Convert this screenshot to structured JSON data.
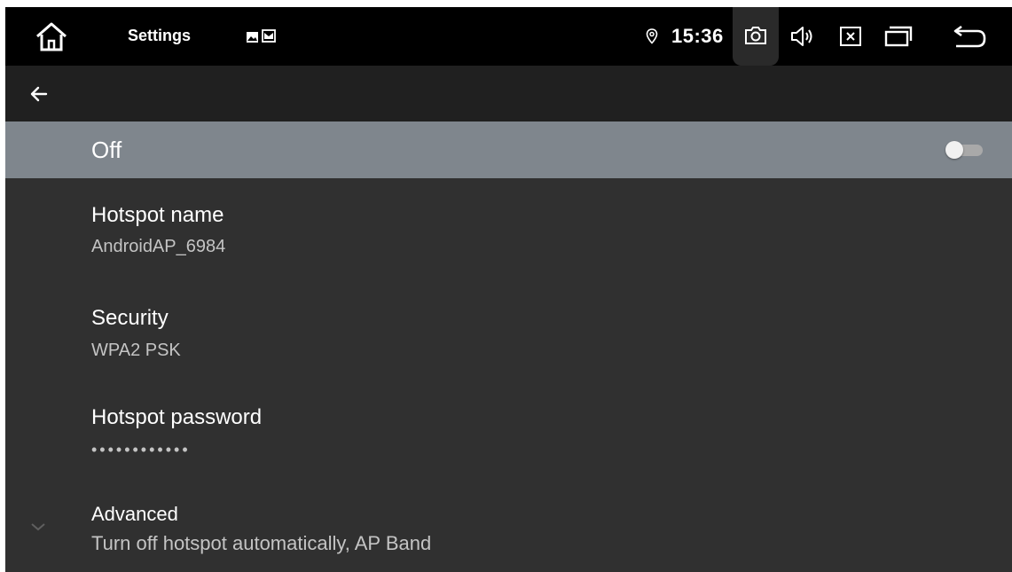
{
  "status_bar": {
    "app_name": "Settings",
    "time": "15:36"
  },
  "toolbar": {
    "back_icon": "arrow-left-icon"
  },
  "master_switch": {
    "label": "Off",
    "state": "off"
  },
  "preferences": [
    {
      "title": "Hotspot name",
      "summary": "AndroidAP_6984"
    },
    {
      "title": "Security",
      "summary": "WPA2 PSK"
    },
    {
      "title": "Hotspot password",
      "summary": "••••••••••••"
    },
    {
      "title": "Advanced",
      "summary": "Turn off hotspot automatically, AP Band"
    }
  ],
  "colors": {
    "background": "#303030",
    "switch_bar": "#7f868d",
    "action_bar": "#202020",
    "status_bar": "#000000"
  }
}
